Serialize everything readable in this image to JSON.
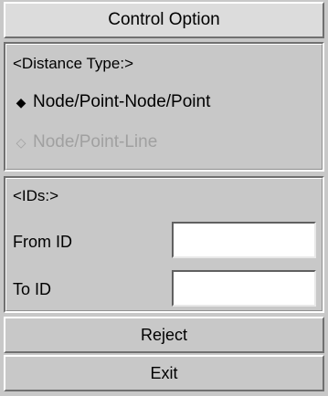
{
  "header": {
    "title": "Control Option"
  },
  "distance_type": {
    "heading": "<Distance Type:>",
    "options": [
      {
        "label": "Node/Point-Node/Point",
        "selected": true,
        "enabled": true,
        "icon": "filled-diamond"
      },
      {
        "label": "Node/Point-Line",
        "selected": false,
        "enabled": false,
        "icon": "hollow-diamond"
      }
    ]
  },
  "ids": {
    "heading": "<IDs:>",
    "from_label": "From ID",
    "from_value": "",
    "to_label": "To ID",
    "to_value": ""
  },
  "buttons": {
    "reject": "Reject",
    "exit": "Exit"
  },
  "colors": {
    "background": "#c8c8c8",
    "disabled_text": "#a0a0a0"
  }
}
